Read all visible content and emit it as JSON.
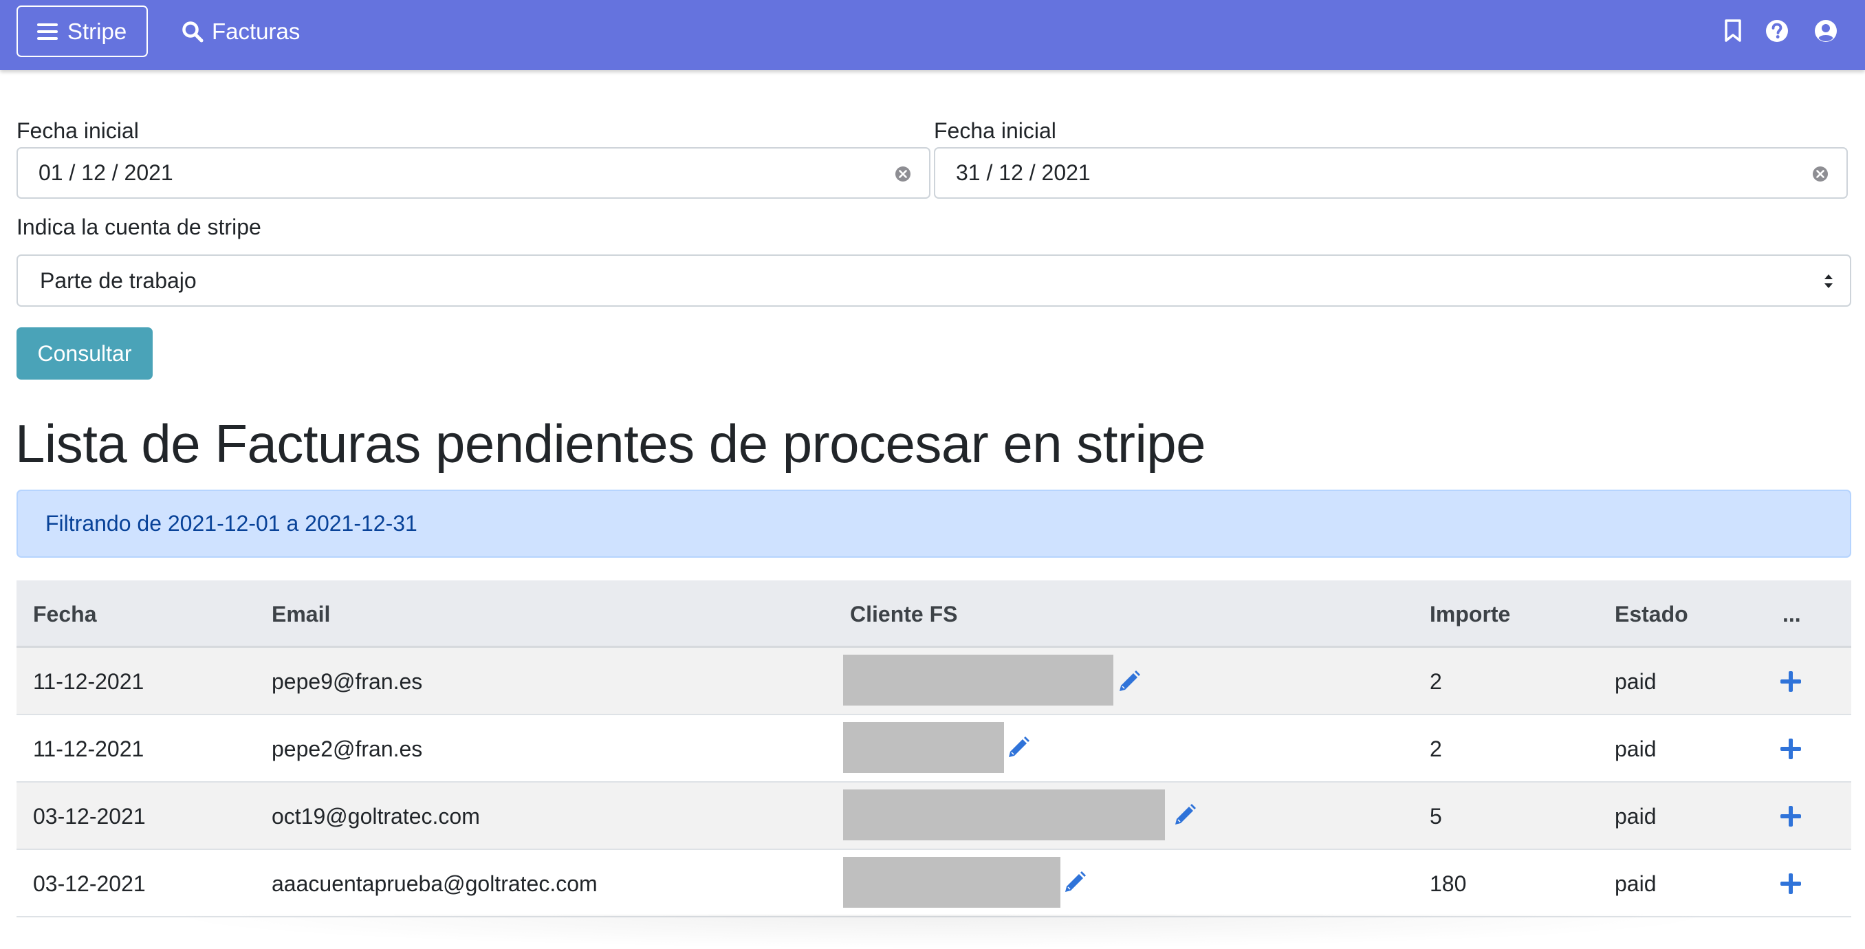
{
  "navbar": {
    "brand_label": "Stripe",
    "search_label": "Facturas",
    "icons": [
      "menu-icon",
      "search-icon",
      "bookmark-icon",
      "help-icon",
      "user-icon"
    ],
    "bg_color": "#6573de"
  },
  "form": {
    "start_date_label": "Fecha inicial",
    "start_date_value": "01 / 12 / 2021",
    "end_date_label": "Fecha inicial",
    "end_date_value": "31 / 12 / 2021",
    "account_label": "Indica la cuenta de stripe",
    "account_selected": "Parte de trabajo",
    "submit_label": "Consultar",
    "submit_color": "#4aa3b8"
  },
  "main": {
    "title": "Lista de Facturas pendientes de procesar en stripe",
    "alert_text": "Filtrando de 2021-12-01 a 2021-12-31",
    "alert_color": "#cfe2ff"
  },
  "table": {
    "headers": {
      "fecha": "Fecha",
      "email": "Email",
      "cliente": "Cliente FS",
      "importe": "Importe",
      "estado": "Estado",
      "actions": "..."
    },
    "rows": [
      {
        "fecha": "11-12-2021",
        "email": "pepe9@fran.es",
        "importe": "2",
        "estado": "paid"
      },
      {
        "fecha": "11-12-2021",
        "email": "pepe2@fran.es",
        "importe": "2",
        "estado": "paid"
      },
      {
        "fecha": "03-12-2021",
        "email": "oct19@goltratec.com",
        "importe": "5",
        "estado": "paid"
      },
      {
        "fecha": "03-12-2021",
        "email": "aaacuentaprueba@goltratec.com",
        "importe": "180",
        "estado": "paid"
      }
    ],
    "link_color": "#2f73d9"
  }
}
